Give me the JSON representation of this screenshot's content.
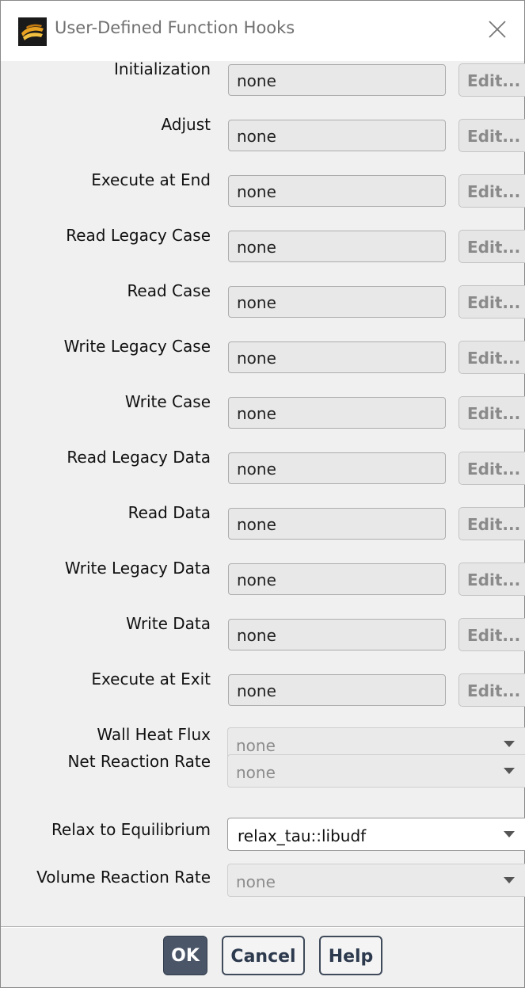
{
  "window": {
    "title": "User-Defined Function Hooks"
  },
  "hooks": [
    {
      "label": "Initialization",
      "value": "none",
      "edit_label": "Edit..."
    },
    {
      "label": "Adjust",
      "value": "none",
      "edit_label": "Edit..."
    },
    {
      "label": "Execute at End",
      "value": "none",
      "edit_label": "Edit..."
    },
    {
      "label": "Read Legacy Case",
      "value": "none",
      "edit_label": "Edit..."
    },
    {
      "label": "Read Case",
      "value": "none",
      "edit_label": "Edit..."
    },
    {
      "label": "Write Legacy Case",
      "value": "none",
      "edit_label": "Edit..."
    },
    {
      "label": "Write Case",
      "value": "none",
      "edit_label": "Edit..."
    },
    {
      "label": "Read Legacy Data",
      "value": "none",
      "edit_label": "Edit..."
    },
    {
      "label": "Read Data",
      "value": "none",
      "edit_label": "Edit..."
    },
    {
      "label": "Write Legacy Data",
      "value": "none",
      "edit_label": "Edit..."
    },
    {
      "label": "Write Data",
      "value": "none",
      "edit_label": "Edit..."
    },
    {
      "label": "Execute at Exit",
      "value": "none",
      "edit_label": "Edit..."
    }
  ],
  "dropdowns": [
    {
      "label": "Wall Heat Flux",
      "value": "none",
      "enabled": false
    },
    {
      "label": "Net Reaction Rate",
      "value": "none",
      "enabled": false
    },
    {
      "label": "Relax to Equilibrium",
      "value": "relax_tau::libudf",
      "enabled": true
    },
    {
      "label": "Volume Reaction Rate",
      "value": "none",
      "enabled": false
    }
  ],
  "buttons": {
    "ok": "OK",
    "cancel": "Cancel",
    "help": "Help"
  },
  "icons": {
    "app": "fluent-logo-icon",
    "close": "close-icon"
  }
}
